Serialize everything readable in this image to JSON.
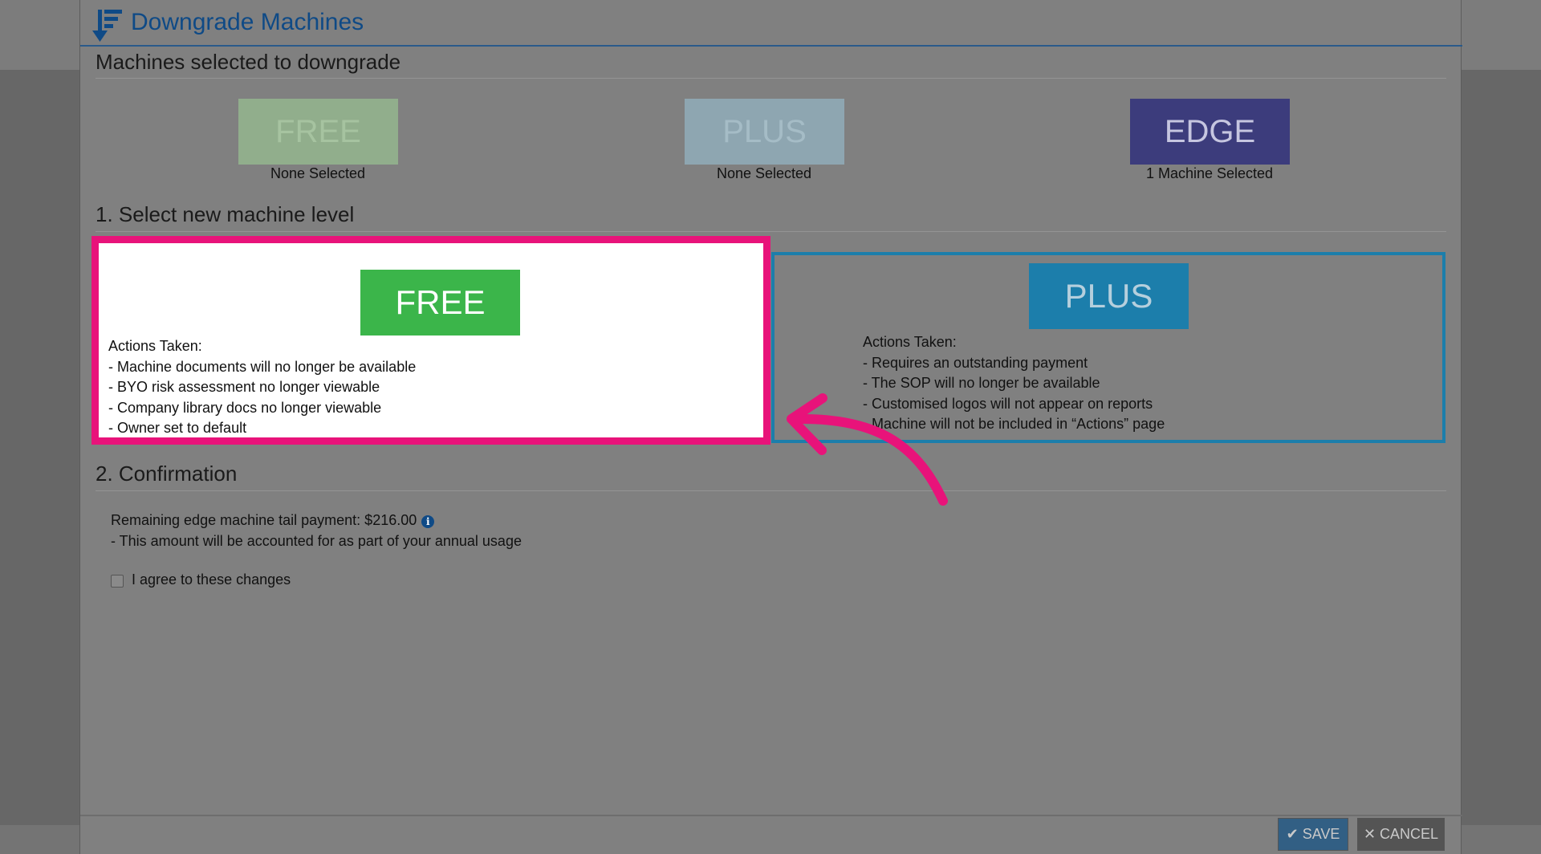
{
  "header": {
    "title": "Downgrade Machines",
    "logo_icon": "downgrade-logo-icon"
  },
  "selected_section": {
    "title": "Machines selected to downgrade",
    "tiers": [
      {
        "label": "FREE",
        "caption": "None Selected",
        "color": "#91ae8c"
      },
      {
        "label": "PLUS",
        "caption": "None Selected",
        "color": "#8ea6b1"
      },
      {
        "label": "EDGE",
        "caption": "1 Machine Selected",
        "color": "#3c3c7c"
      }
    ]
  },
  "level_section": {
    "title": "1. Select new machine level",
    "options": [
      {
        "label": "FREE",
        "color": "#3bb54a",
        "actions_heading": "Actions Taken:",
        "actions": [
          " - Machine documents will no longer be available",
          " - BYO risk assessment no longer viewable",
          " - Company library docs no longer viewable",
          " - Owner set to default"
        ]
      },
      {
        "label": "PLUS",
        "color": "#1c7eab",
        "actions_heading": "Actions Taken:",
        "actions": [
          " - Requires an outstanding payment",
          " - The SOP will no longer be available",
          " - Customised logos will not appear on reports",
          " - Machine will not be included in “Actions” page"
        ]
      }
    ]
  },
  "confirmation": {
    "title": "2. Confirmation",
    "payment_line": "Remaining edge machine tail payment: $216.00",
    "payment_note": " - This amount will be accounted for as part of your annual usage",
    "agree_label": "I agree to these changes",
    "info_icon": "info-icon"
  },
  "footer": {
    "save_label": "SAVE",
    "cancel_label": "CANCEL"
  },
  "annotation": {
    "highlight_color": "#e8137a"
  }
}
